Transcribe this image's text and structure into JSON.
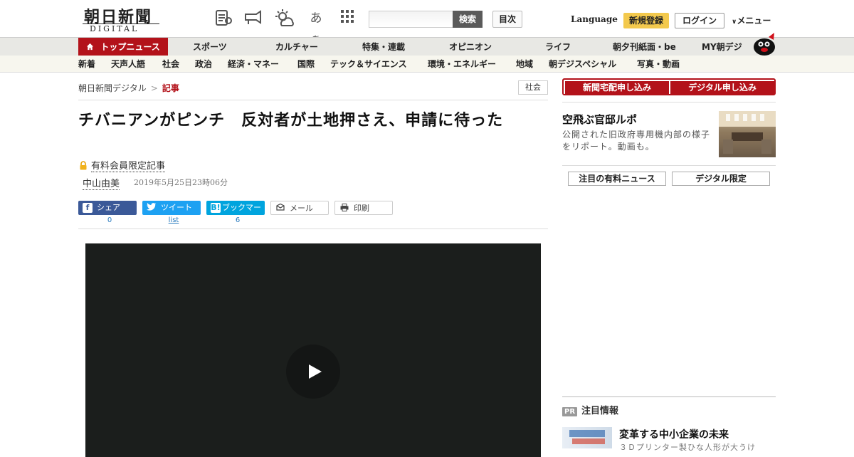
{
  "header": {
    "logo_text": "朝日新聞",
    "logo_sub": "DIGITAL",
    "font_size_label": "あ",
    "font_size_label_small": "あ",
    "search_button": "検索",
    "toc_button": "目次",
    "language": "Language",
    "register": "新規登録",
    "login": "ログイン",
    "menu": "メニュー"
  },
  "nav_main": [
    {
      "label": "トップニュース"
    },
    {
      "label": "スポーツ"
    },
    {
      "label": "カルチャー"
    },
    {
      "label": "特集・連載"
    },
    {
      "label": "オピニオン"
    },
    {
      "label": "ライフ"
    },
    {
      "label": "朝夕刊紙面・be"
    },
    {
      "label": "MY朝デジ"
    }
  ],
  "nav_sub": [
    {
      "label": "新着"
    },
    {
      "label": "天声人語"
    },
    {
      "label": "社会"
    },
    {
      "label": "政治"
    },
    {
      "label": "経済・マネー"
    },
    {
      "label": "国際"
    },
    {
      "label": "テック＆サイエンス"
    },
    {
      "label": "環境・エネルギー"
    },
    {
      "label": "地域"
    },
    {
      "label": "朝デジスペシャル"
    },
    {
      "label": "写真・動画"
    }
  ],
  "breadcrumb": {
    "home": "朝日新聞デジタル",
    "separator": ">",
    "current": "記事"
  },
  "category_badge": "社会",
  "article": {
    "title": "チバニアンがピンチ　反対者が土地押さえ、申請に待った",
    "paid_label": "有料会員限定記事",
    "author": "中山由美",
    "date": "2019年5月25日23時06分"
  },
  "share": {
    "facebook": "シェア",
    "facebook_count": "0",
    "twitter": "ツイート",
    "twitter_count": "list",
    "hatena": "ブックマーク",
    "hatena_count": "6",
    "mail": "メール",
    "print": "印刷"
  },
  "sidebar": {
    "subscribe_paper": "新聞宅配申し込み",
    "subscribe_digital": "デジタル申し込み",
    "promo_title": "空飛ぶ官邸ルポ",
    "promo_desc": "公開された旧政府専用機内部の様子をリポート。動画も。",
    "tab_paid_news": "注目の有料ニュース",
    "tab_digital_only": "デジタル限定",
    "pr_badge": "PR",
    "pr_heading": "注目情報",
    "pr_title": "変革する中小企業の未来",
    "pr_desc": "３Ｄプリンター製ひな人形が大うけ"
  },
  "colors": {
    "brand_red": "#b3121a",
    "register_yellow": "#f3c94d",
    "facebook": "#3b5998",
    "twitter": "#1da1f2",
    "hatena": "#00a4de"
  }
}
